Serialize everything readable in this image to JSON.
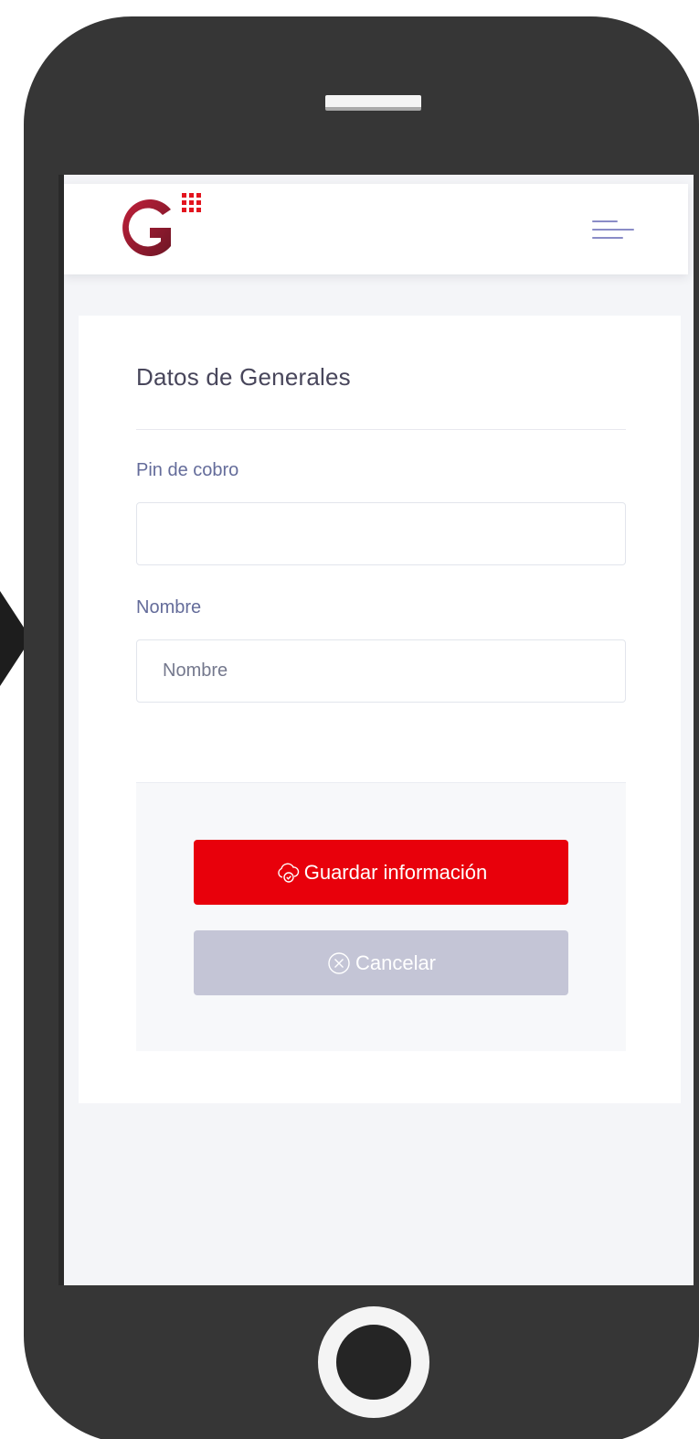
{
  "header": {
    "menu_icon": "hamburger-menu-icon",
    "brand_color": "#9b1b30"
  },
  "form": {
    "title": "Datos de Generales",
    "fields": [
      {
        "label": "Pin de cobro",
        "value": "",
        "placeholder": ""
      },
      {
        "label": "Nombre",
        "value": "",
        "placeholder": "Nombre"
      }
    ]
  },
  "actions": {
    "save_label": "Guardar información",
    "save_icon": "cloud-check-icon",
    "save_color": "#e8000b",
    "cancel_label": "Cancelar",
    "cancel_icon": "circle-x-icon",
    "cancel_color": "#c4c5d6"
  }
}
